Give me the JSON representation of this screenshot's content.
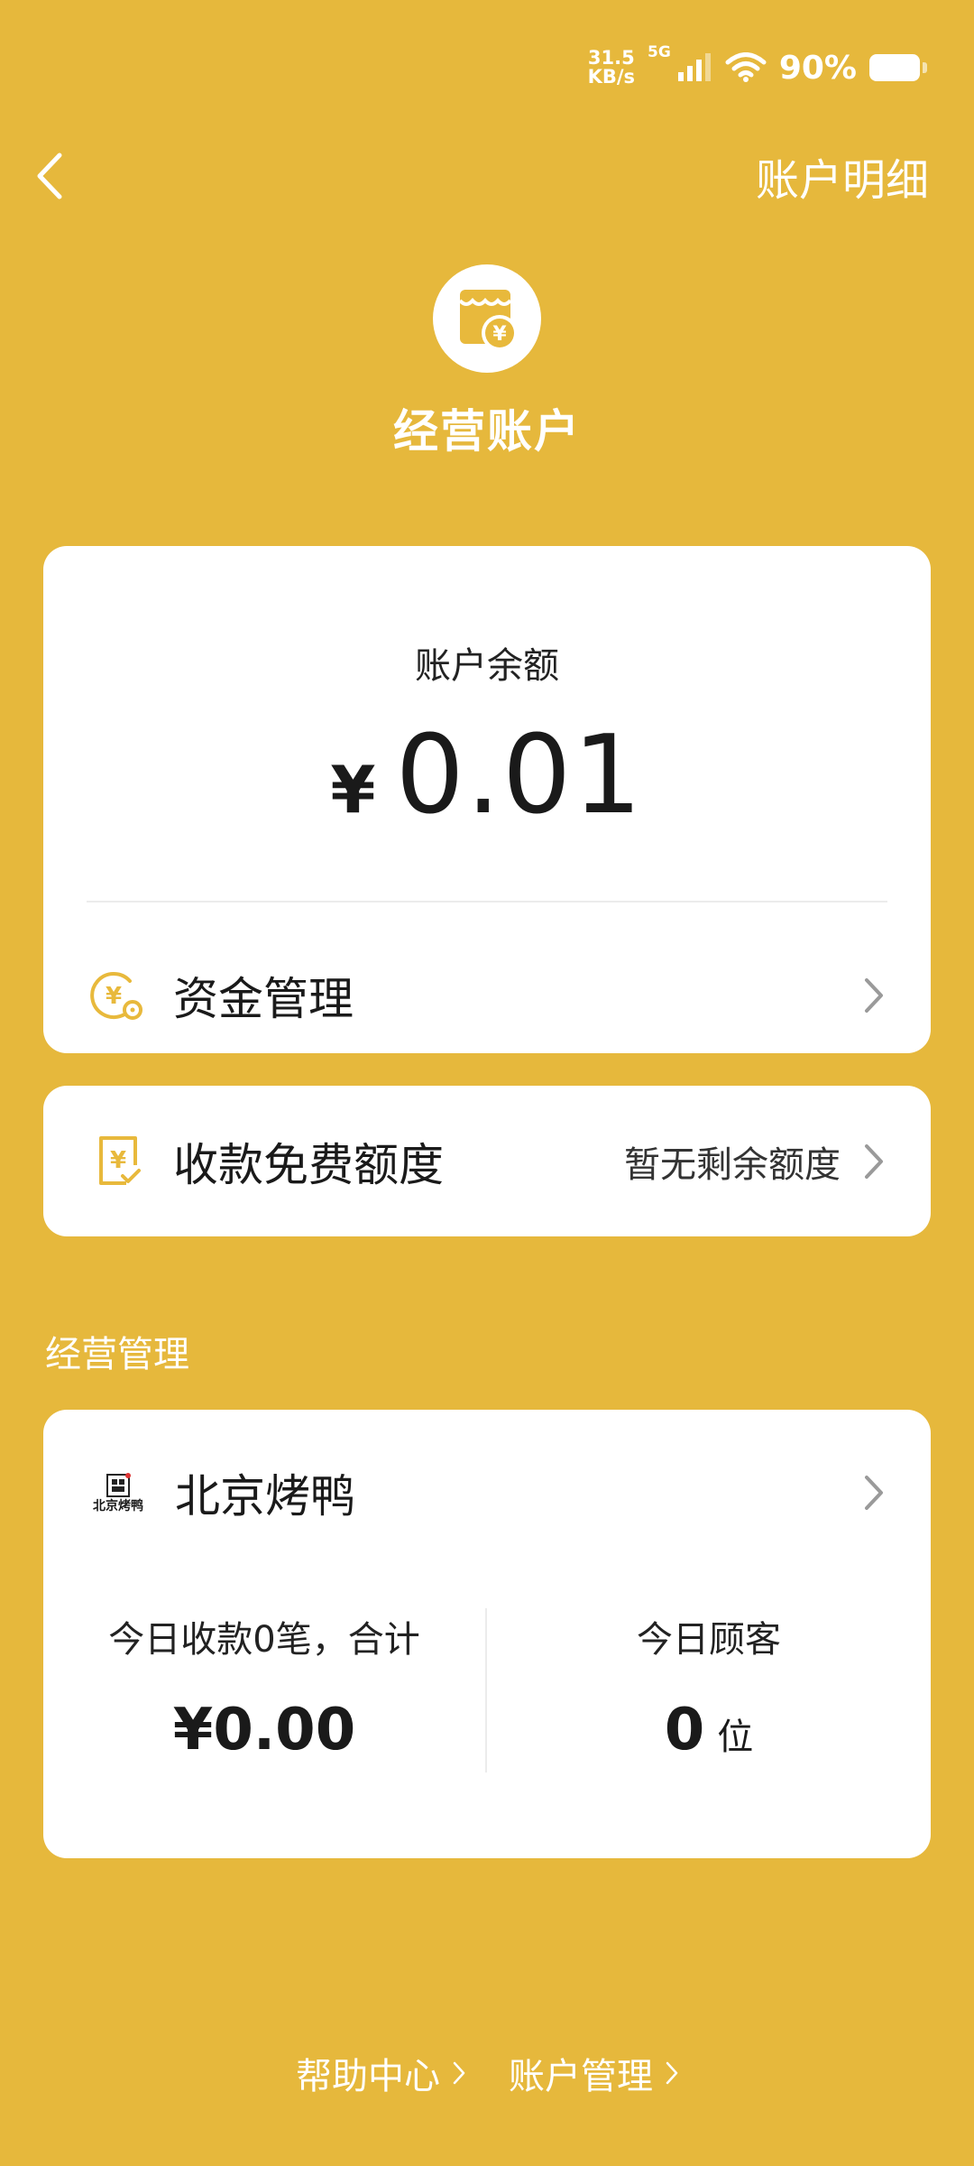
{
  "status_bar": {
    "net_speed_value": "31.5",
    "net_speed_unit": "KB/s",
    "network": "5G",
    "battery": "90%"
  },
  "nav": {
    "right_label": "账户明细"
  },
  "header": {
    "title": "经营账户"
  },
  "balance": {
    "label": "账户余额",
    "currency": "¥",
    "amount": "0.01"
  },
  "fund_management": {
    "label": "资金管理"
  },
  "free_quota": {
    "label": "收款免费额度",
    "value": "暂无剩余额度"
  },
  "section": {
    "label": "经营管理"
  },
  "store": {
    "name": "北京烤鸭",
    "logo_text": "北京烤鸭",
    "today_income_label": "今日收款0笔，合计",
    "today_income_value": "¥0.00",
    "today_customers_label": "今日顾客",
    "today_customers_value": "0",
    "today_customers_unit": "位"
  },
  "footer": {
    "help_center": "帮助中心",
    "account_management": "账户管理"
  },
  "colors": {
    "background": "#E6B83C",
    "accent": "#E8B93C",
    "card": "#FFFFFF"
  }
}
